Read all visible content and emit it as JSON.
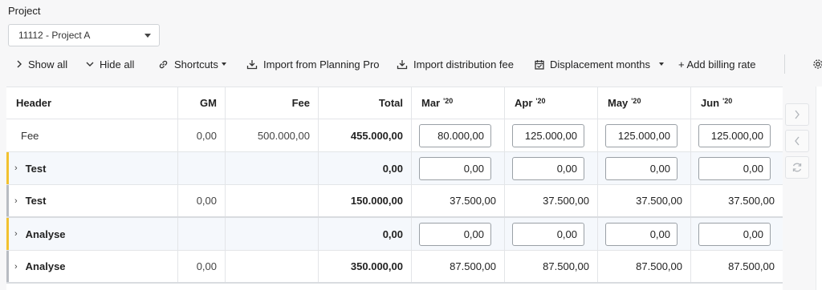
{
  "project": {
    "label": "Project",
    "selected": "11112 - Project A"
  },
  "toolbar": {
    "show_all": "Show all",
    "hide_all": "Hide all",
    "shortcuts": "Shortcuts",
    "import_planning": "Import from Planning Pro",
    "import_distribution": "Import distribution fee",
    "displacement": "Displacement months",
    "add_billing": "+ Add billing rate"
  },
  "table": {
    "headers": {
      "header": "Header",
      "gm": "GM",
      "fee": "Fee",
      "total": "Total",
      "months": [
        {
          "name": "Mar",
          "year": "'20"
        },
        {
          "name": "Apr",
          "year": "'20"
        },
        {
          "name": "May",
          "year": "'20"
        },
        {
          "name": "Jun",
          "year": "'20"
        }
      ]
    },
    "rows": [
      {
        "label": "Fee",
        "gm": "0,00",
        "fee": "500.000,00",
        "total": "455.000,00",
        "months": [
          "80.000,00",
          "125.000,00",
          "125.000,00",
          "125.000,00"
        ]
      },
      {
        "label": "Test",
        "gm": "",
        "fee": "",
        "total": "0,00",
        "months": [
          "0,00",
          "0,00",
          "0,00",
          "0,00"
        ]
      },
      {
        "label": "Test",
        "gm": "0,00",
        "fee": "",
        "total": "150.000,00",
        "months": [
          "37.500,00",
          "37.500,00",
          "37.500,00",
          "37.500,00"
        ]
      },
      {
        "label": "Analyse",
        "gm": "",
        "fee": "",
        "total": "0,00",
        "months": [
          "0,00",
          "0,00",
          "0,00",
          "0,00"
        ]
      },
      {
        "label": "Analyse",
        "gm": "0,00",
        "fee": "",
        "total": "350.000,00",
        "months": [
          "87.500,00",
          "87.500,00",
          "87.500,00",
          "87.500,00"
        ]
      }
    ]
  },
  "colors": {
    "accent_yellow": "#f2c12e",
    "accent_gray": "#b8bcc2"
  }
}
